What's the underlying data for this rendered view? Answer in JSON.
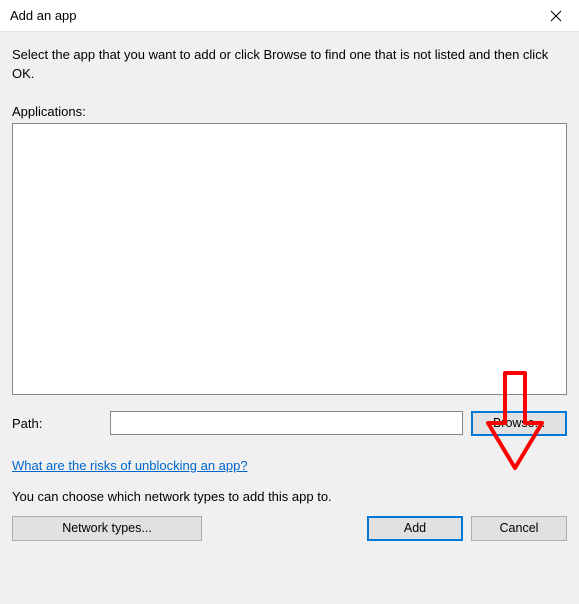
{
  "window": {
    "title": "Add an app"
  },
  "content": {
    "instruction": "Select the app that you want to add or click Browse to find one that is not listed and then click OK.",
    "applications_label": "Applications:",
    "path_label": "Path:",
    "path_value": "",
    "browse_button": "Browse...",
    "risks_link": "What are the risks of unblocking an app?",
    "network_description": "You can choose which network types to add this app to.",
    "network_types_button": "Network types...",
    "add_button": "Add",
    "cancel_button": "Cancel"
  },
  "annotation": {
    "arrow_color": "#ff0000"
  }
}
